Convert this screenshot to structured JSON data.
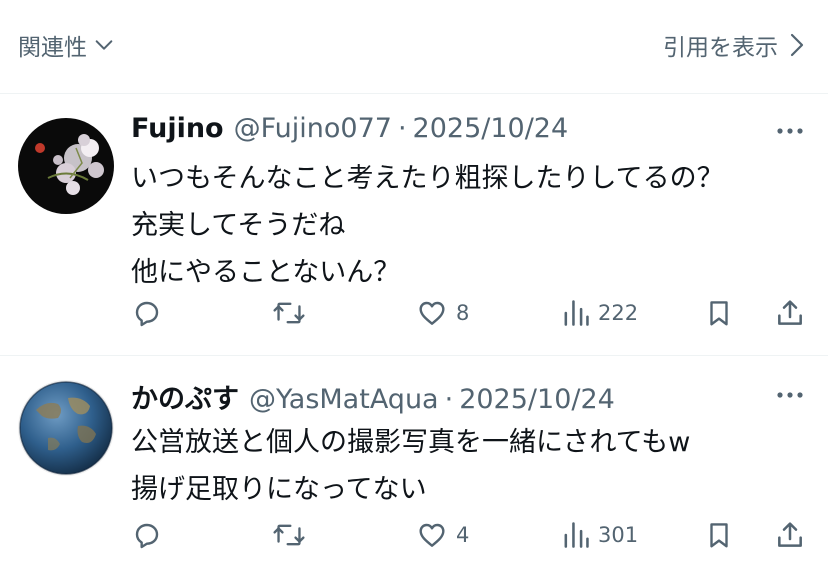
{
  "filter_bar": {
    "sort_label": "関連性",
    "quotes_label": "引用を表示"
  },
  "tweets": [
    {
      "display_name": "Fujino",
      "handle": "@Fujino077",
      "separator": "·",
      "date": "2025/10/24",
      "lines": [
        "いつもそんなこと考えたり粗探したりしてるの？",
        "充実してそうだね",
        "他にやることないん？"
      ],
      "likes": "8",
      "views": "222",
      "avatar_icon": "cherry-blossom-avatar"
    },
    {
      "display_name": "かのぷす",
      "handle": "@YasMatAqua",
      "separator": "·",
      "date": "2025/10/24",
      "lines": [
        "公営放送と個人の撮影写真を一緒にされてもw",
        "揚げ足取りになってない"
      ],
      "likes": "4",
      "views": "301",
      "avatar_icon": "earth-globe-avatar"
    }
  ],
  "colors": {
    "text_primary": "#0f1419",
    "text_secondary": "#536471",
    "divider": "#eff3f4"
  }
}
